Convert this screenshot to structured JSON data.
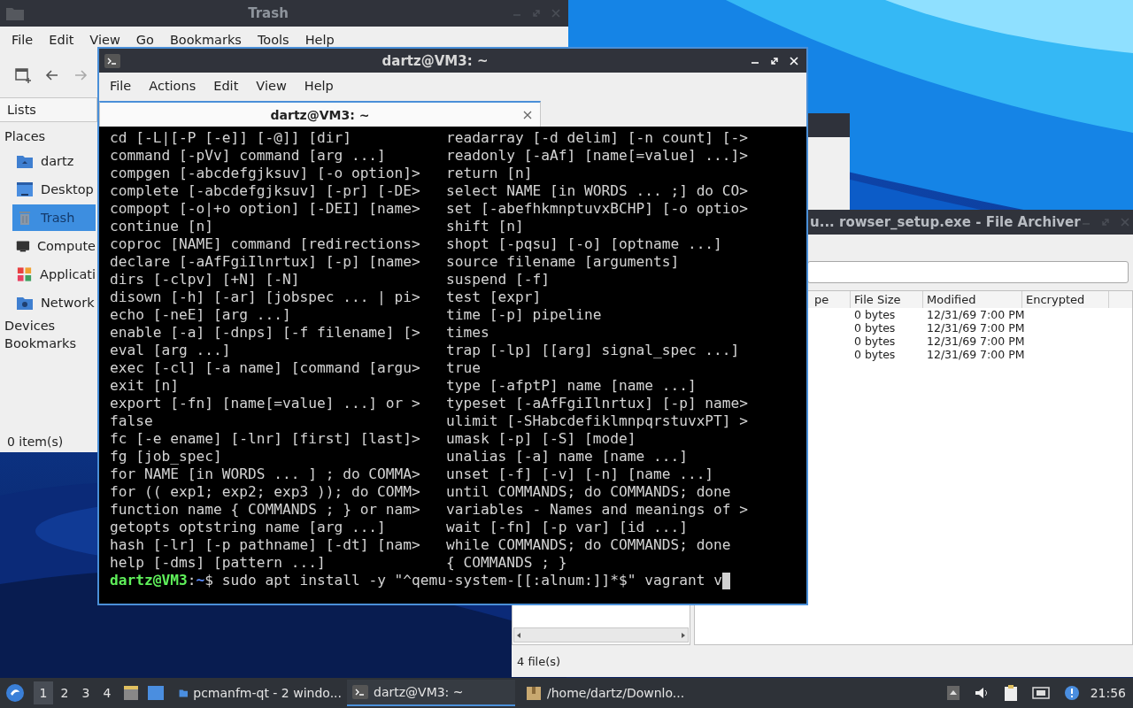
{
  "file_manager": {
    "title": "Trash",
    "menu": [
      "File",
      "Edit",
      "View",
      "Go",
      "Bookmarks",
      "Tools",
      "Help"
    ],
    "panel_tab": "Lists",
    "places_heading": "Places",
    "places": [
      {
        "label": "dartz",
        "kind": "home",
        "selected": false
      },
      {
        "label": "Desktop",
        "kind": "desktop",
        "selected": false
      },
      {
        "label": "Trash",
        "kind": "trash",
        "selected": true
      },
      {
        "label": "Compute",
        "kind": "computer",
        "selected": false
      },
      {
        "label": "Applicati",
        "kind": "applications",
        "selected": false
      },
      {
        "label": "Network",
        "kind": "network",
        "selected": false
      }
    ],
    "sections": [
      "Devices",
      "Bookmarks"
    ],
    "status": "0 item(s)"
  },
  "archiver": {
    "title": "u... rowser_setup.exe - File Archiver",
    "columns": [
      "pe",
      "File Size",
      "Modified",
      "Encrypted"
    ],
    "rows": [
      {
        "size": "0 bytes",
        "modified": "12/31/69 7:00 PM"
      },
      {
        "size": "0 bytes",
        "modified": "12/31/69 7:00 PM"
      },
      {
        "size": "0 bytes",
        "modified": "12/31/69 7:00 PM"
      },
      {
        "size": "0 bytes",
        "modified": "12/31/69 7:00 PM"
      }
    ],
    "status": "4 file(s)"
  },
  "terminal": {
    "title": "dartz@VM3: ~",
    "menu": [
      "File",
      "Actions",
      "Edit",
      "View",
      "Help"
    ],
    "tabs": [
      {
        "label": "dartz@VM3: ~",
        "selected": true
      }
    ],
    "lines": [
      {
        "left": "cd [-L|[-P [-e]] [-@]] [dir]",
        "right": "readarray [-d delim] [-n count] [->"
      },
      {
        "left": "command [-pVv] command [arg ...]",
        "right": "readonly [-aAf] [name[=value] ...]>"
      },
      {
        "left": "compgen [-abcdefgjksuv] [-o option]>",
        "right": "return [n]"
      },
      {
        "left": "complete [-abcdefgjksuv] [-pr] [-DE>",
        "right": "select NAME [in WORDS ... ;] do CO>"
      },
      {
        "left": "compopt [-o|+o option] [-DEI] [name>",
        "right": "set [-abefhkmnptuvxBCHP] [-o optio>"
      },
      {
        "left": "continue [n]",
        "right": "shift [n]"
      },
      {
        "left": "coproc [NAME] command [redirections>",
        "right": "shopt [-pqsu] [-o] [optname ...]"
      },
      {
        "left": "declare [-aAfFgiIlnrtux] [-p] [name>",
        "right": "source filename [arguments]"
      },
      {
        "left": "dirs [-clpv] [+N] [-N]",
        "right": "suspend [-f]"
      },
      {
        "left": "disown [-h] [-ar] [jobspec ... | pi>",
        "right": "test [expr]"
      },
      {
        "left": "echo [-neE] [arg ...]",
        "right": "time [-p] pipeline"
      },
      {
        "left": "enable [-a] [-dnps] [-f filename] [>",
        "right": "times"
      },
      {
        "left": "eval [arg ...]",
        "right": "trap [-lp] [[arg] signal_spec ...]"
      },
      {
        "left": "exec [-cl] [-a name] [command [argu>",
        "right": "true"
      },
      {
        "left": "exit [n]",
        "right": "type [-afptP] name [name ...]"
      },
      {
        "left": "export [-fn] [name[=value] ...] or >",
        "right": "typeset [-aAfFgiIlnrtux] [-p] name>"
      },
      {
        "left": "false",
        "right": "ulimit [-SHabcdefiklmnpqrstuvxPT] >"
      },
      {
        "left": "fc [-e ename] [-lnr] [first] [last]>",
        "right": "umask [-p] [-S] [mode]"
      },
      {
        "left": "fg [job_spec]",
        "right": "unalias [-a] name [name ...]"
      },
      {
        "left": "for NAME [in WORDS ... ] ; do COMMA>",
        "right": "unset [-f] [-v] [-n] [name ...]"
      },
      {
        "left": "for (( exp1; exp2; exp3 )); do COMM>",
        "right": "until COMMANDS; do COMMANDS; done"
      },
      {
        "left": "function name { COMMANDS ; } or nam>",
        "right": "variables - Names and meanings of >"
      },
      {
        "left": "getopts optstring name [arg ...]",
        "right": "wait [-fn] [-p var] [id ...]"
      },
      {
        "left": "hash [-lr] [-p pathname] [-dt] [nam>",
        "right": "while COMMANDS; do COMMANDS; done"
      },
      {
        "left": "help [-dms] [pattern ...]",
        "right": "{ COMMANDS ; }"
      }
    ],
    "prompt": {
      "user_host": "dartz@VM3",
      "separator": ":",
      "path": "~",
      "command": "$ sudo apt install -y \"^qemu-system-[[:alnum:]]*$\" vagrant v"
    }
  },
  "taskbar": {
    "desktops": [
      {
        "label": "1",
        "selected": true
      },
      {
        "label": "2",
        "selected": false
      },
      {
        "label": "3",
        "selected": false
      },
      {
        "label": "4",
        "selected": false
      }
    ],
    "tasks": [
      {
        "label": "pcmanfm-qt - 2 windo...",
        "kind": "folder",
        "selected": false
      },
      {
        "label": "dartz@VM3: ~",
        "kind": "terminal",
        "selected": true
      },
      {
        "label": "/home/dartz/Downlo...",
        "kind": "archive",
        "selected": false
      }
    ],
    "clock": "21:56"
  }
}
